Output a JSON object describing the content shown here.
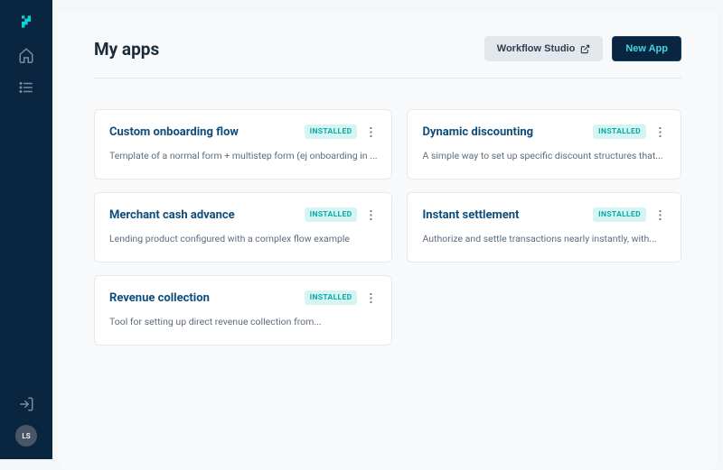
{
  "header": {
    "title": "My apps",
    "workflow_btn": "Workflow Studio",
    "new_app_btn": "New App"
  },
  "badge_label": "INSTALLED",
  "avatar_initials": "LS",
  "apps": [
    {
      "title": "Custom onboarding flow",
      "desc": "Template of a normal form + multistep form (ej onboarding in ..."
    },
    {
      "title": "Dynamic discounting",
      "desc": "A simple way to set up specific discount structures that..."
    },
    {
      "title": "Merchant cash advance",
      "desc": "Lending product configured with a complex flow example"
    },
    {
      "title": "Instant settlement",
      "desc": "Authorize and settle transactions nearly instantly, with..."
    },
    {
      "title": "Revenue collection",
      "desc": "Tool for setting up direct revenue collection from..."
    }
  ]
}
